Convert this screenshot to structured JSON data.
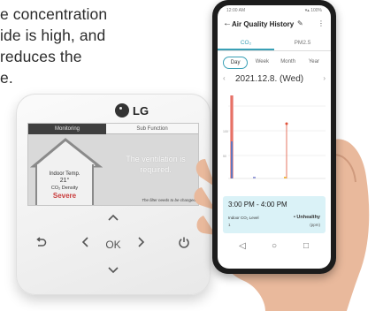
{
  "caption": {
    "lines": [
      "e concentration",
      "ide is high, and",
      "reduces the",
      "e."
    ]
  },
  "controller": {
    "brand": "LG",
    "tabs": {
      "monitoring": "Monitoring",
      "sub_function": "Sub Function"
    },
    "indoor_temp_label": "Indoor Temp.",
    "indoor_temp_value": "21°",
    "co2_label": "CO₂ Density",
    "co2_status": "Severe",
    "message": "The ventilation is required.",
    "filter_notice": "The filter needs to be changed",
    "buttons": {
      "up": "^",
      "down": "v",
      "left": "<",
      "right": ">",
      "ok": "OK",
      "back": "↶",
      "power": "⏻"
    }
  },
  "phone": {
    "status": {
      "time": "12:00 AM",
      "signal": "▾▴ 100%"
    },
    "header": {
      "back_icon": "←",
      "title": "Air Quality History",
      "edit_icon": "✎",
      "more_icon": "⋮"
    },
    "tabs": [
      "CO₂",
      "PM2.5"
    ],
    "active_tab": "CO₂",
    "periods": [
      "Day",
      "Week",
      "Month",
      "Year"
    ],
    "active_period": "Day",
    "date": "2021.12.8. (Wed)",
    "chart_marks": {
      "accent": "#e0523a",
      "line": "#2f6fd0",
      "grid": "#e5e5e5",
      "highlight": "#f0a3a3"
    },
    "popup": {
      "time": "3:00 PM - 4:00 PM",
      "label": "Indoor CO₂ Level",
      "status": "• Unhealthy",
      "value": "1",
      "unit": "(ppm)"
    },
    "nav": {
      "back": "◁",
      "home": "○",
      "recent": "□"
    },
    "accent": "#3aa0b6"
  }
}
